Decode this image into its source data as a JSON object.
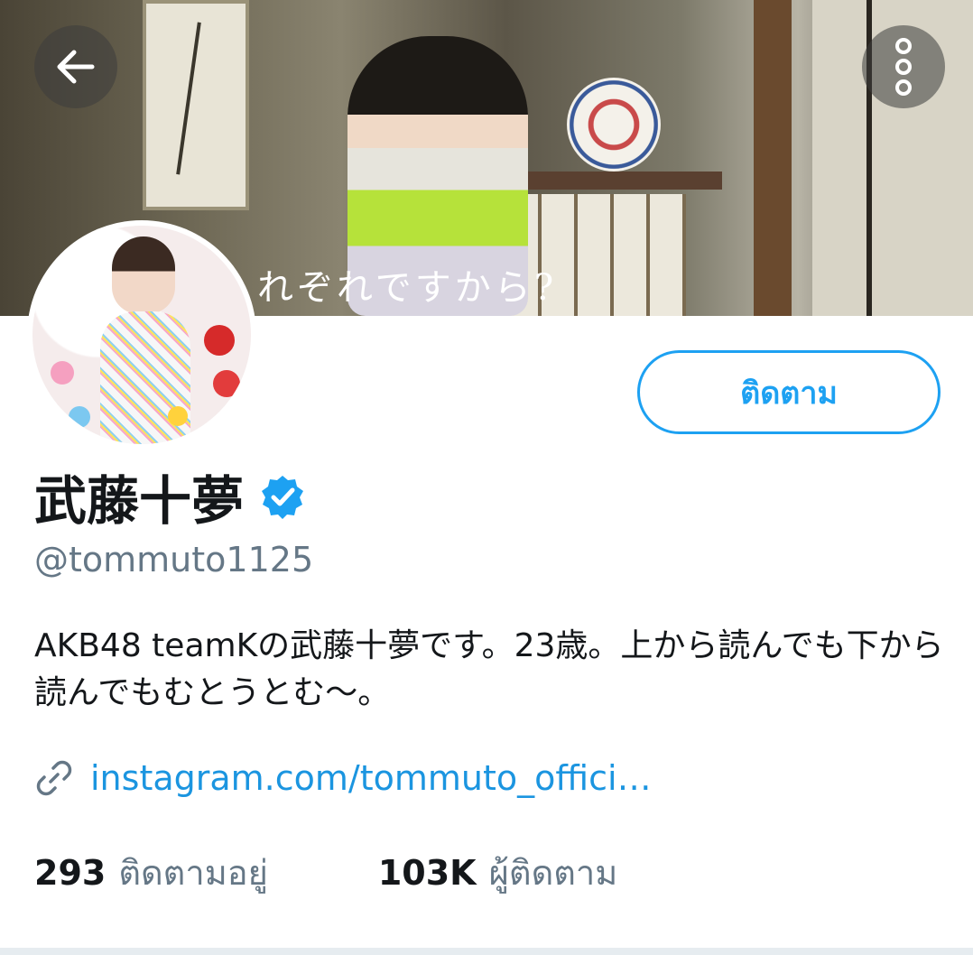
{
  "banner": {
    "caption": "れぞれですから?"
  },
  "header": {
    "back_icon": "arrow-left-icon",
    "more_icon": "more-vertical-icon"
  },
  "profile": {
    "display_name": "武藤十夢",
    "verified": true,
    "handle": "@tommuto1125",
    "bio": "AKB48 teamKの武藤十夢です。23歳。上から読んでも下から読んでもむとうとむ〜。",
    "link_icon": "link-icon",
    "link": "instagram.com/tommuto_offici…",
    "follow_button_label": "ติดตาม"
  },
  "stats": {
    "following_count": "293",
    "following_label": "ติดตามอยู่",
    "followers_count": "103K",
    "followers_label": "ผู้ติดตาม"
  },
  "colors": {
    "accent": "#1da1f2",
    "link": "#1b95e0",
    "secondary_text": "#657786",
    "primary_text": "#14171a"
  }
}
